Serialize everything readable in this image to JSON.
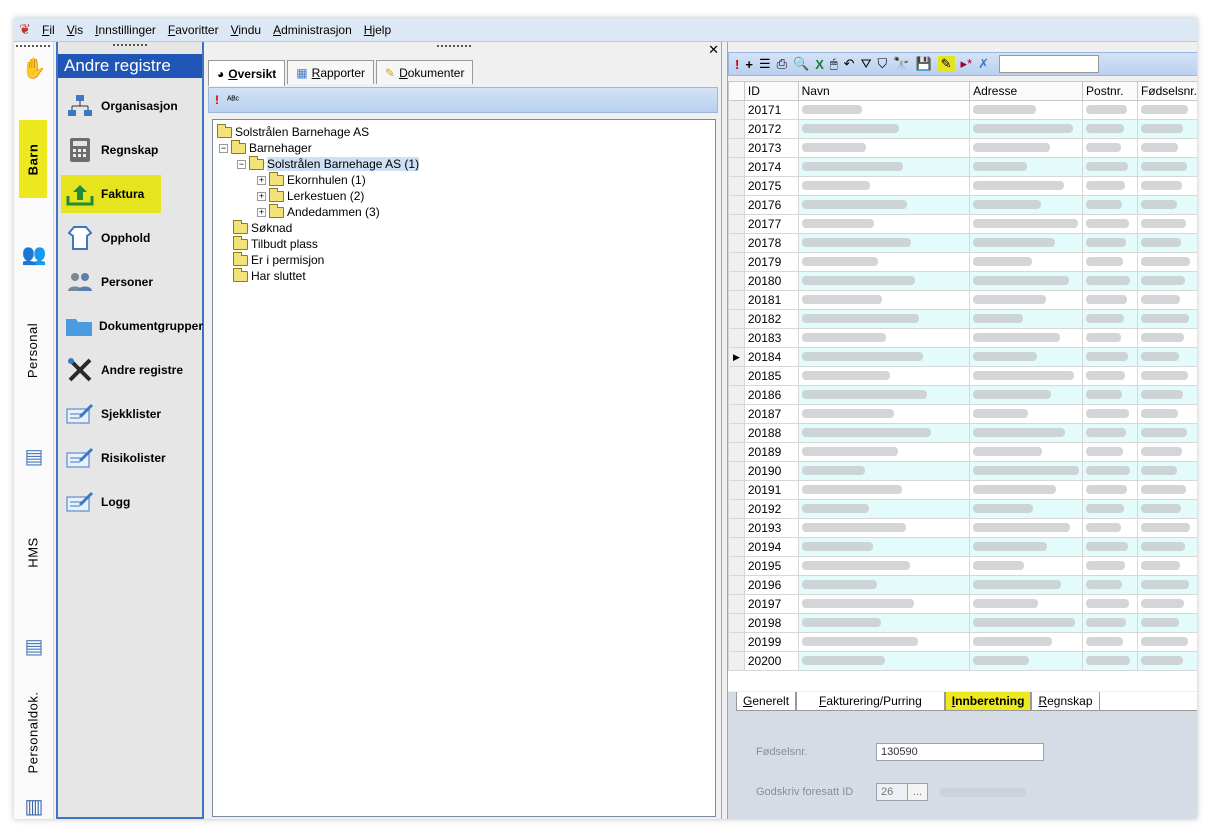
{
  "menubar": {
    "items": [
      "Fil",
      "Vis",
      "Innstillinger",
      "Favoritter",
      "Vindu",
      "Administrasjon",
      "Hjelp"
    ]
  },
  "strip": {
    "tabs": [
      "Barn",
      "Personal",
      "HMS",
      "Personaldok."
    ]
  },
  "registry": {
    "title": "Andre registre",
    "items": [
      {
        "label": "Organisasjon",
        "icon": "org-chart-icon"
      },
      {
        "label": "Regnskap",
        "icon": "calculator-icon"
      },
      {
        "label": "Faktura",
        "icon": "upload-icon"
      },
      {
        "label": "Opphold",
        "icon": "baby-clothes-icon"
      },
      {
        "label": "Personer",
        "icon": "people-icon"
      },
      {
        "label": "Dokumentgrupper",
        "icon": "folder-icon"
      },
      {
        "label": "Andre registre",
        "icon": "tools-icon"
      },
      {
        "label": "Sjekklister",
        "icon": "checklist-icon"
      },
      {
        "label": "Risikolister",
        "icon": "checklist-icon"
      },
      {
        "label": "Logg",
        "icon": "log-icon"
      }
    ]
  },
  "treepanel": {
    "tabs": [
      "Oversikt",
      "Rapporter",
      "Dokumenter"
    ],
    "tree": [
      "Solstrålen Barnehage AS",
      "Barnehager",
      "Solstrålen Barnehage AS (1)",
      "Ekornhulen (1)",
      "Lerkestuen (2)",
      "Andedammen (3)",
      "Søknad",
      "Tilbudt plass",
      "Er i permisjon",
      "Har sluttet"
    ]
  },
  "grid": {
    "columns": [
      "ID",
      "Navn",
      "Adresse",
      "Postnr.",
      "Fødselsnr."
    ],
    "ids": [
      "20171",
      "20172",
      "20173",
      "20174",
      "20175",
      "20176",
      "20177",
      "20178",
      "20179",
      "20180",
      "20181",
      "20182",
      "20183",
      "20184",
      "20185",
      "20186",
      "20187",
      "20188",
      "20189",
      "20190",
      "20191",
      "20192",
      "20193",
      "20194",
      "20195",
      "20196",
      "20197",
      "20198",
      "20199",
      "20200"
    ],
    "current_row_id": "20184"
  },
  "detail": {
    "tabs": [
      "Generelt",
      "Fakturering/Purring",
      "Innberetning",
      "Regnskap"
    ],
    "active_tab": "Innberetning",
    "fodselsnr_label": "Fødselsnr.",
    "fodselsnr_value": "130590",
    "godskriv_label": "Godskriv foresatt ID",
    "godskriv_value": "26",
    "browse_label": "..."
  },
  "colors": {
    "accent": "#1f55b6",
    "highlight": "#e6e31f",
    "toolbar": "#c7daf2",
    "row_alt": "#e3fbfb"
  }
}
